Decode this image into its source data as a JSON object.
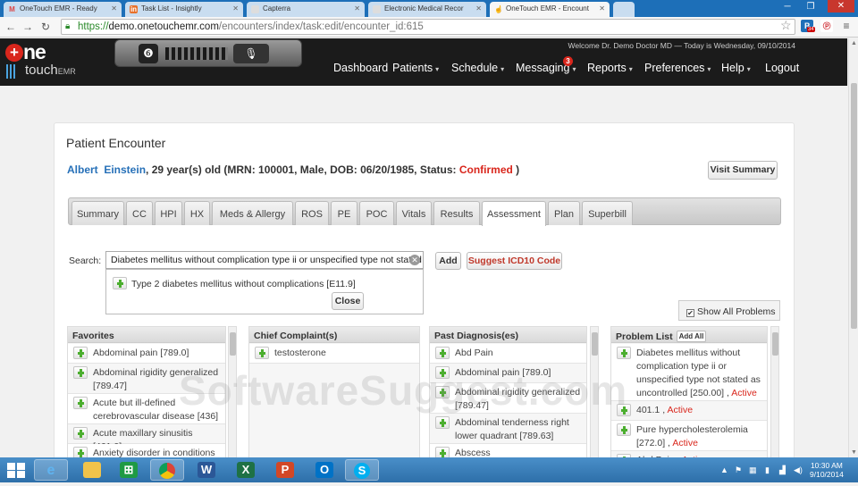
{
  "browser": {
    "tabs": [
      {
        "icon": "M",
        "icon_color": "#d44",
        "label": "OneTouch EMR - Ready"
      },
      {
        "icon": "in",
        "icon_color": "#e8712a",
        "label": "Task List - Insightly"
      },
      {
        "icon": "",
        "icon_color": "#888",
        "label": "Capterra"
      },
      {
        "icon": "",
        "icon_color": "#888",
        "label": "Electronic Medical Recor"
      },
      {
        "icon": "☝",
        "icon_color": "#333",
        "label": "OneTouch EMR - Encount"
      }
    ],
    "url_scheme": "https://",
    "url_host": "demo.onetouchemr.com",
    "url_path": "/encounters/index/task:edit/encounter_id:615",
    "ext_badge": "34"
  },
  "app": {
    "logo_one": "ne",
    "logo_touch": "touch",
    "logo_emr": "EMR",
    "welcome": "Welcome Dr. Demo Doctor MD — Today is Wednesday, 09/10/2014",
    "menu": [
      {
        "label": "Dashboard",
        "caret": ""
      },
      {
        "label": "Patients",
        "caret": "▾"
      },
      {
        "label": "Schedule",
        "caret": "▾"
      },
      {
        "label": "Messaging",
        "caret": "▾"
      },
      {
        "label": "Reports",
        "caret": "▾"
      },
      {
        "label": "Preferences",
        "caret": "▾"
      },
      {
        "label": "Help",
        "caret": "▾"
      },
      {
        "label": "Logout",
        "caret": ""
      }
    ],
    "messaging_badge": "3"
  },
  "encounter": {
    "title": "Patient Encounter",
    "first_name": "Albert",
    "last_name": "Einstein",
    "details": ", 29 year(s) old (MRN: 100001, Male, DOB: 06/20/1985, Status: ",
    "status": "Confirmed",
    "details_end": " )",
    "visit_summary": "Visit Summary",
    "tabs": [
      "Summary",
      "CC",
      "HPI",
      "HX",
      "Meds & Allergy",
      "ROS",
      "PE",
      "POC",
      "Vitals",
      "Results",
      "Assessment",
      "Plan",
      "Superbill"
    ],
    "active_tab": "Assessment"
  },
  "assessment": {
    "search_label": "Search:",
    "search_value": "Diabetes mellitus without complication type ii or unspecified type not stated as uncontrolled",
    "add_label": "Add",
    "suggest_label": "Suggest ICD10 Code",
    "suggestion": "Type 2 diabetes mellitus without complications [E11.9]",
    "close_label": "Close",
    "show_all_label": "Show All Problems",
    "show_all_checked": "✔"
  },
  "columns": {
    "favorites": {
      "title": "Favorites",
      "items": [
        "Abdominal pain [789.0]",
        "Abdominal rigidity generalized [789.47]",
        "Acute but ill-defined cerebrovascular disease [436]",
        "Acute maxillary sinusitis [461.0]",
        "Anxiety disorder in conditions"
      ]
    },
    "chief_complaint": {
      "title": "Chief Complaint(s)",
      "items": [
        "testosterone"
      ]
    },
    "past_diagnosis": {
      "title": "Past Diagnosis(es)",
      "items": [
        "Abd Pain",
        "Abdominal pain [789.0]",
        "Abdominal rigidity generalized [789.47]",
        "Abdominal tenderness right lower quadrant [789.63]",
        "Abscess"
      ]
    },
    "problem_list": {
      "title": "Problem List",
      "add_all": "Add All",
      "items": [
        {
          "text": "Diabetes mellitus without complication type ii or unspecified type not stated as uncontrolled [250.00]",
          "sep": " , ",
          "status": "Active"
        },
        {
          "text": "401.1",
          "sep": " , ",
          "status": "Active"
        },
        {
          "text": "Pure hypercholesterolemia [272.0]",
          "sep": " , ",
          "status": "Active"
        },
        {
          "text": "Abd Pain",
          "sep": " , ",
          "status": "Active"
        }
      ]
    }
  },
  "watermark": "SoftwareSuggest.com",
  "taskbar": {
    "time": "10:30 AM",
    "date": "9/10/2014"
  }
}
